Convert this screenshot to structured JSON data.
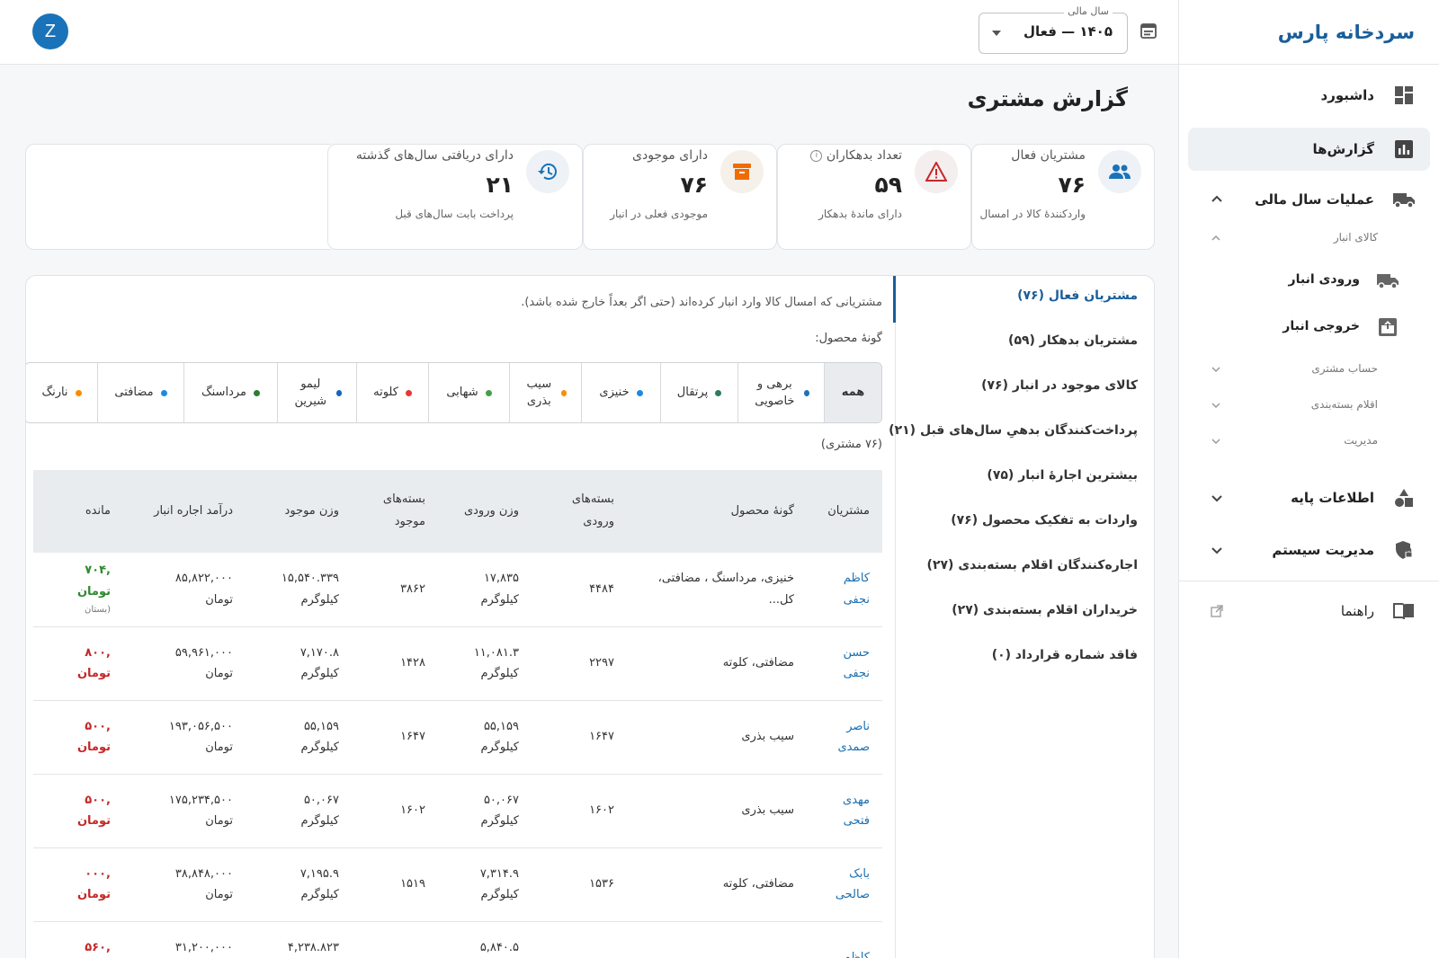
{
  "app": {
    "brand": "سردخانه پارس"
  },
  "topbar": {
    "avatar_letter": "Z",
    "year_legend": "سال مالی",
    "year_value": "۱۴۰۵ — فعال"
  },
  "sidebar": {
    "dashboard": "داشبورد",
    "reports": "گزارش‌ها",
    "fiscal_ops": "عملیات سال مالی",
    "warehouse_goods": "کالای انبار",
    "warehouse_in": "ورودی انبار",
    "warehouse_out": "خروجی انبار",
    "customer_account": "حساب مشتری",
    "packaging_items": "اقلام بسته‌بندی",
    "management": "مدیریت",
    "base_info": "اطلاعات پایه",
    "system_admin": "مدیریت سیستم",
    "guide": "راهنما"
  },
  "page": {
    "title": "گزارش مشتری"
  },
  "kpis": [
    {
      "label": "مشتریان فعال",
      "value": "۷۶",
      "sub": "واردکنندهٔ کالا در امسال",
      "icon": "users-icon",
      "color": "#1a73b8"
    },
    {
      "label": "تعداد بدهکاران",
      "value": "۵۹",
      "sub": "دارای ماندهٔ بدهکار",
      "icon": "warning-icon",
      "color": "#c62828"
    },
    {
      "label": "دارای موجودی",
      "value": "۷۶",
      "sub": "موجودی فعلی در انبار",
      "icon": "archive-icon",
      "color": "#ef6c00"
    },
    {
      "label": "دارای دریافتی سال‌های گذشته",
      "value": "۲۱",
      "sub": "پرداخت بابت سال‌های قبل",
      "icon": "history-icon",
      "color": "#1a73b8"
    }
  ],
  "report_nav": [
    "مشتریان فعال (۷۶)",
    "مشتریان بدهکار (۵۹)",
    "کالای موجود در انبار (۷۶)",
    "پرداخت‌کنندگان بدهیِ سال‌های قبل (۲۱)",
    "بیشترین اجارهٔ انبار (۷۵)",
    "واردات به تفکیک محصول (۷۶)",
    "اجاره‌کنندگان اقلام بسته‌بندی (۲۷)",
    "خریداران اقلام بسته‌بندی (۲۷)",
    "فاقد شماره قرارداد (۰)"
  ],
  "main": {
    "description": "مشتریانی که امسال کالا وارد انبار کرده‌اند (حتی اگر بعداً خارج شده باشد).",
    "filter_title": "گونهٔ محصول:",
    "count": "(۷۶ مشتری)"
  },
  "chips": [
    {
      "label": "همه",
      "color": ""
    },
    {
      "label": "برهی و خاصویی",
      "color": "#1a73b8"
    },
    {
      "label": "پرتقال",
      "color": "#2e7d5b"
    },
    {
      "label": "خنیزی",
      "color": "#1e88e5"
    },
    {
      "label": "سیب بذری",
      "color": "#fb8c00"
    },
    {
      "label": "شهابی",
      "color": "#43a047"
    },
    {
      "label": "کلوته",
      "color": "#e53935"
    },
    {
      "label": "لیمو شیرین",
      "color": "#1565c0"
    },
    {
      "label": "مرداسنگ",
      "color": "#2e7d32"
    },
    {
      "label": "مضافتی",
      "color": "#1e88e5"
    },
    {
      "label": "نارنگ",
      "color": "#fb8c00"
    }
  ],
  "table": {
    "headers": [
      "مشتریان",
      "گونهٔ محصول",
      "بسته‌های ورودی",
      "وزن ورودی",
      "بسته‌های موجود",
      "وزن موجود",
      "درآمد اجاره انبار",
      "مانده"
    ],
    "rows": [
      {
        "customer": "کاظم نجفی",
        "type": "خنیزی، مرداسنگ ، مضافتی، کل...",
        "in_pkgs": "۴۴۸۴",
        "in_weight": "۱۷,۸۳۵",
        "stock_pkgs": "۳۸۶۲",
        "stock_weight": "۱۵,۵۴۰.۳۳۹",
        "rent": "۸۵,۸۲۲,۰۰۰",
        "balance": ",۷۰۴",
        "balance_sign": "pos",
        "balance_note": "(بستان"
      },
      {
        "customer": "حسن نجفی",
        "type": "مضافتی، کلوته",
        "in_pkgs": "۲۲۹۷",
        "in_weight": "۱۱,۰۸۱.۳",
        "stock_pkgs": "۱۴۲۸",
        "stock_weight": "۷,۱۷۰.۸",
        "rent": "۵۹,۹۶۱,۰۰۰",
        "balance": ",۸۰۰",
        "balance_sign": "neg",
        "balance_note": ""
      },
      {
        "customer": "ناصر صمدی",
        "type": "سیب بذری",
        "in_pkgs": "۱۶۴۷",
        "in_weight": "۵۵,۱۵۹",
        "stock_pkgs": "۱۶۴۷",
        "stock_weight": "۵۵,۱۵۹",
        "rent": "۱۹۳,۰۵۶,۵۰۰",
        "balance": ",۵۰۰",
        "balance_sign": "neg",
        "balance_note": ""
      },
      {
        "customer": "مهدی فتحی",
        "type": "سیب بذری",
        "in_pkgs": "۱۶۰۲",
        "in_weight": "۵۰,۰۶۷",
        "stock_pkgs": "۱۶۰۲",
        "stock_weight": "۵۰,۰۶۷",
        "rent": "۱۷۵,۲۳۴,۵۰۰",
        "balance": ",۵۰۰",
        "balance_sign": "neg",
        "balance_note": ""
      },
      {
        "customer": "بابک صالحی",
        "type": "مضافتی، کلوته",
        "in_pkgs": "۱۵۳۶",
        "in_weight": "۷,۳۱۴.۹",
        "stock_pkgs": "۱۵۱۹",
        "stock_weight": "۷,۱۹۵.۹",
        "rent": "۳۸,۸۴۸,۰۰۰",
        "balance": ",۰۰۰",
        "balance_sign": "neg",
        "balance_note": ""
      },
      {
        "customer": "کاظم",
        "type": "",
        "in_pkgs": "",
        "in_weight": "۵,۸۴۰.۵",
        "stock_pkgs": "",
        "stock_weight": "۴,۲۳۸.۸۲۳",
        "rent": "۳۱,۲۰۰,۰۰۰",
        "balance": ",۵۶۰",
        "balance_sign": "neg",
        "balance_note": ""
      }
    ],
    "unit_kg": "کیلوگرم",
    "unit_toman": "تومان"
  }
}
